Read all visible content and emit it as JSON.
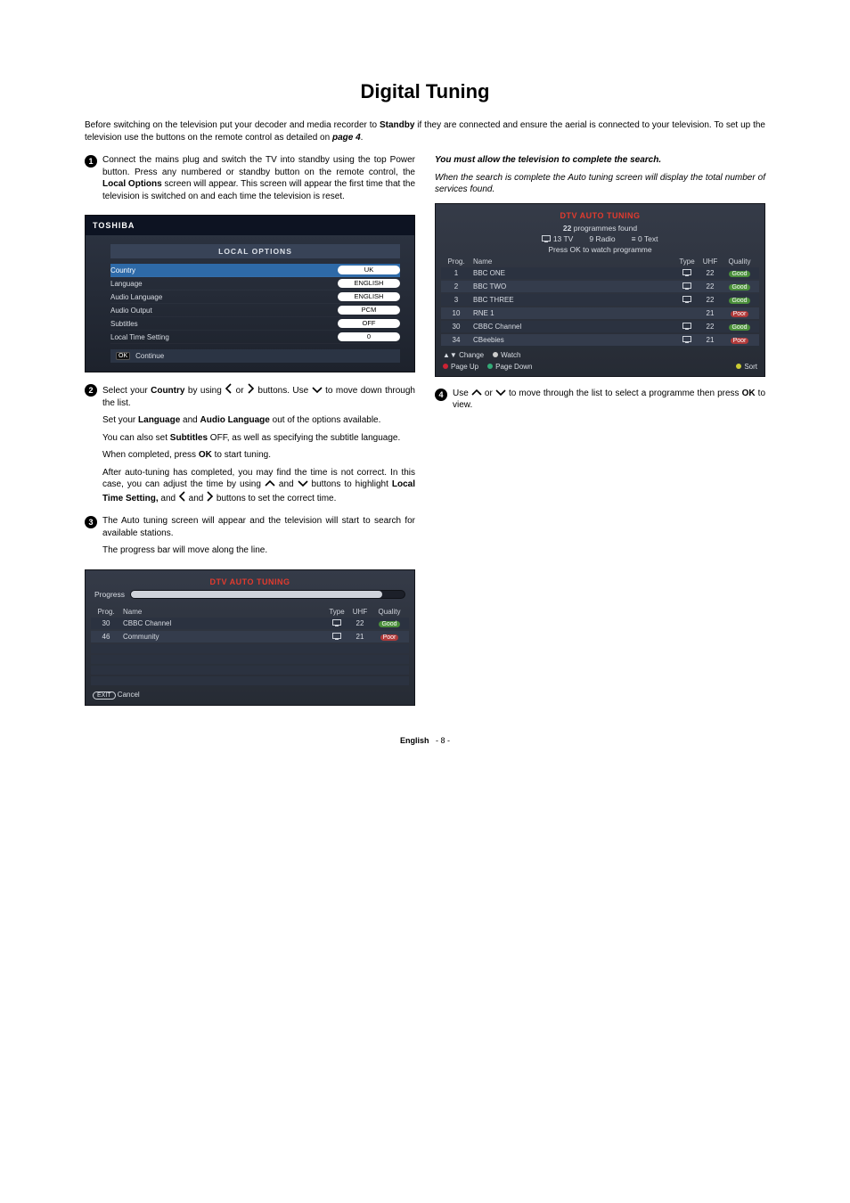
{
  "page": {
    "title": "Digital Tuning",
    "footer_lang": "English",
    "footer_page": "- 8 -"
  },
  "intro": {
    "pre": "Before switching on the television put your decoder and media recorder to ",
    "standby": "Standby",
    "mid": " if they are connected and ensure the aerial is connected to your television. To set up the television use the buttons on the remote control as detailed on ",
    "page4": "page 4",
    "end": "."
  },
  "step1": {
    "num": "1",
    "t1": "Connect the mains plug and switch the TV into standby using the top Power button. Press any numbered or standby button on the remote control, the ",
    "local_opt": "Local Options",
    "t2": " screen will appear. This screen will appear the first time that the television is switched on and each time the television is reset."
  },
  "local_options": {
    "brand": "TOSHIBA",
    "title": "LOCAL OPTIONS",
    "rows": [
      {
        "label": "Country",
        "value": "UK",
        "selected": true
      },
      {
        "label": "Language",
        "value": "ENGLISH"
      },
      {
        "label": "Audio Language",
        "value": "ENGLISH"
      },
      {
        "label": "Audio Output",
        "value": "PCM"
      },
      {
        "label": "Subtitles",
        "value": "OFF"
      },
      {
        "label": "Local Time Setting",
        "value": "0"
      }
    ],
    "continue": "Continue",
    "ok": "OK"
  },
  "step2": {
    "num": "2",
    "a1": "Select your ",
    "country": "Country",
    "a2": " by using ",
    "a3": " or ",
    "a4": " buttons. Use ",
    "a5": " to move down through the list.",
    "b1": "Set your ",
    "lang": "Language",
    "b2": " and ",
    "alang": "Audio Language",
    "b3": " out of the options available.",
    "c1": "You can also set ",
    "subs": "Subtitles",
    "c2": " OFF, as well as specifying the subtitle language.",
    "d1": "When completed, press ",
    "ok": "OK",
    "d2": " to start tuning.",
    "e1": "After auto-tuning has completed, you may find the time is not correct. In this case, you can adjust the time by using ",
    "e2": " and ",
    "e3": " buttons to highlight ",
    "lts": "Local Time Setting,",
    "e4": " and ",
    "e5": " and ",
    "e6": " buttons to set the correct time."
  },
  "step3": {
    "num": "3",
    "t1": "The Auto tuning screen will appear and the television will start to search for available stations.",
    "t2": "The progress bar will move along the line."
  },
  "dtv_scan": {
    "title": "DTV AUTO TUNING",
    "progress": "Progress",
    "headers": {
      "prog": "Prog.",
      "name": "Name",
      "type": "Type",
      "uhf": "UHF",
      "quality": "Quality"
    },
    "rows": [
      {
        "prog": "30",
        "name": "CBBC Channel",
        "uhf": "22",
        "quality": "Good"
      },
      {
        "prog": "46",
        "name": "Community",
        "uhf": "21",
        "quality": "Poor"
      }
    ],
    "exit": "EXIT",
    "cancel": "Cancel"
  },
  "rightcol": {
    "must": "You must allow the television to complete the search.",
    "when": "When the search is complete the Auto tuning screen will display the total number of services found."
  },
  "dtv_result": {
    "title": "DTV AUTO TUNING",
    "found_pre": "22",
    "found_post": " programmes found",
    "tv_icon": "tv-icon",
    "tv": "13 TV",
    "radio": "9 Radio",
    "text_icon": "text-icon",
    "text": "0  Text",
    "press": "Press OK to watch programme",
    "headers": {
      "prog": "Prog.",
      "name": "Name",
      "type": "Type",
      "uhf": "UHF",
      "quality": "Quality"
    },
    "rows": [
      {
        "prog": "1",
        "name": "BBC ONE",
        "type": "tv",
        "uhf": "22",
        "quality": "Good"
      },
      {
        "prog": "2",
        "name": "BBC TWO",
        "type": "tv",
        "uhf": "22",
        "quality": "Good"
      },
      {
        "prog": "3",
        "name": "BBC THREE",
        "type": "tv",
        "uhf": "22",
        "quality": "Good"
      },
      {
        "prog": "10",
        "name": "RNE 1",
        "type": "",
        "uhf": "21",
        "quality": "Poor"
      },
      {
        "prog": "30",
        "name": "CBBC Channel",
        "type": "tv",
        "uhf": "22",
        "quality": "Good"
      },
      {
        "prog": "34",
        "name": "CBeebies",
        "type": "tv",
        "uhf": "21",
        "quality": "Poor"
      }
    ],
    "hints": {
      "change": "Change",
      "watch": "Watch",
      "pageup": "Page Up",
      "pagedown": "Page Down",
      "sort": "Sort"
    }
  },
  "step4": {
    "num": "4",
    "a1": "Use ",
    "a2": " or ",
    "a3": " to move through the list to select a programme then press ",
    "ok": "OK",
    "a4": " to view."
  }
}
